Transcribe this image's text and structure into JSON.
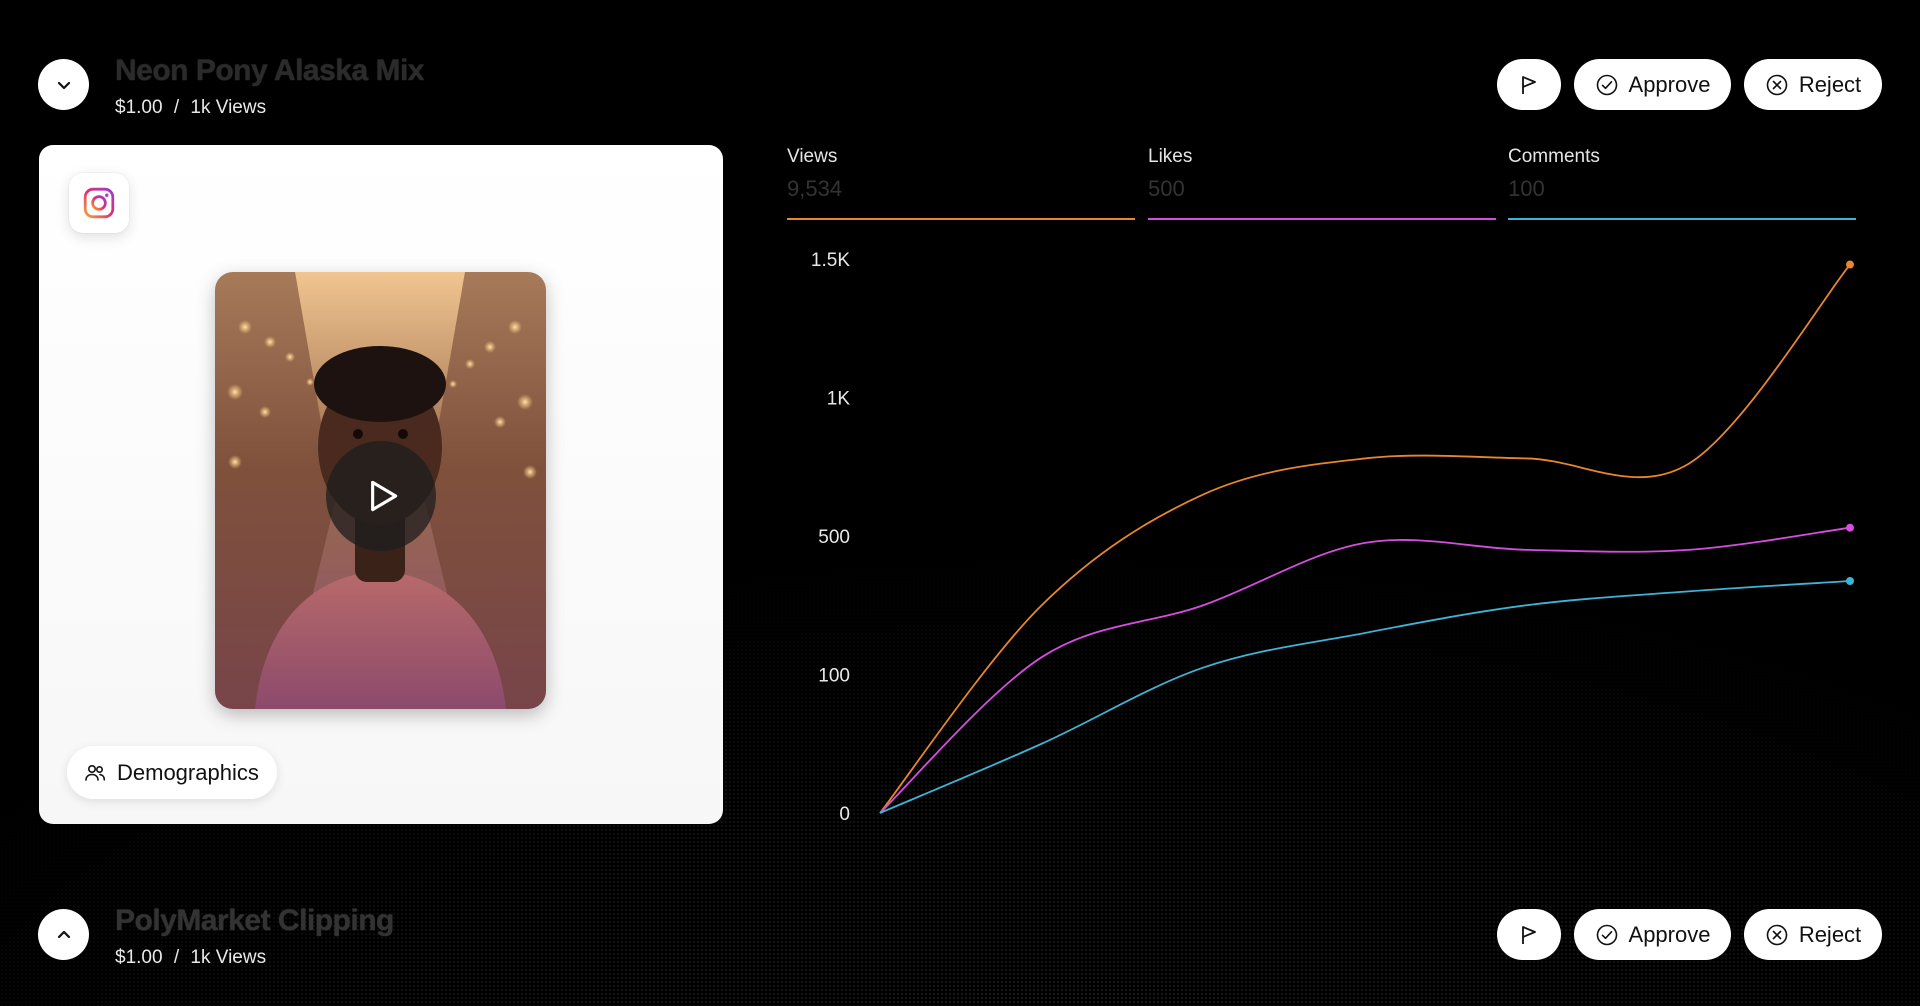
{
  "campaigns": [
    {
      "title": "Neon Pony Alaska Mix",
      "price": "$1.00",
      "separator": "/",
      "views_label": "1k Views",
      "toggle_icon": "chevron-down-icon"
    },
    {
      "title": "PolyMarket Clipping",
      "price": "$1.00",
      "separator": "/",
      "views_label": "1k Views",
      "toggle_icon": "chevron-up-icon"
    }
  ],
  "actions": {
    "flag_icon": "flag-icon",
    "approve_label": "Approve",
    "reject_label": "Reject"
  },
  "media": {
    "platform_icon": "instagram-icon",
    "demographics_label": "Demographics"
  },
  "metrics": [
    {
      "label": "Views",
      "value": "9,534",
      "color": "#e8862c"
    },
    {
      "label": "Likes",
      "value": "500",
      "color": "#d64ee0"
    },
    {
      "label": "Comments",
      "value": "100",
      "color": "#3fb3d6"
    }
  ],
  "chart_data": {
    "type": "line",
    "ytick_labels": [
      "1.5K",
      "1K",
      "500",
      "100",
      "0"
    ],
    "x": [
      0,
      1,
      2,
      3,
      4,
      5,
      6
    ],
    "series": [
      {
        "name": "Views",
        "color": "#e8862c",
        "values": [
          0,
          300,
          650,
          780,
          780,
          760,
          1480
        ]
      },
      {
        "name": "Likes",
        "color": "#d64ee0",
        "values": [
          0,
          150,
          300,
          480,
          460,
          460,
          530
        ]
      },
      {
        "name": "Comments",
        "color": "#3fb3d6",
        "values": [
          0,
          50,
          120,
          220,
          300,
          340,
          370
        ]
      }
    ],
    "grid": false,
    "legend": "top"
  }
}
